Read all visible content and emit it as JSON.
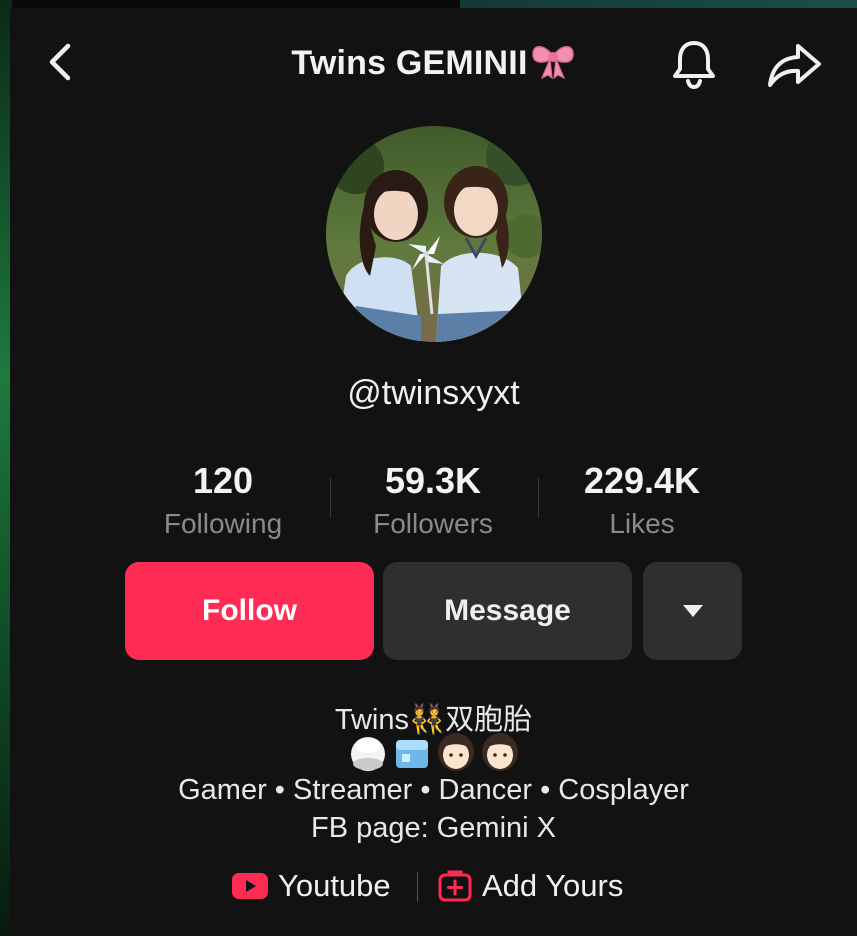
{
  "header": {
    "title": "Twins GEMINII",
    "title_emoji_icon": "ribbon-bow-icon"
  },
  "profile": {
    "username": "@twinsxyxt",
    "avatar_icon": "profile-photo-twins"
  },
  "stats": [
    {
      "value": "120",
      "label": "Following"
    },
    {
      "value": "59.3K",
      "label": "Followers"
    },
    {
      "value": "229.4K",
      "label": "Likes"
    }
  ],
  "actions": {
    "follow_label": "Follow",
    "message_label": "Message"
  },
  "bio": {
    "line1": "Twins👯双胞胎",
    "emoji_icons": [
      "rice-ball-icon",
      "ice-cube-icon",
      "girl-face-icon",
      "girl-face-icon"
    ],
    "line3": "Gamer • Streamer • Dancer • Cosplayer",
    "line4": "FB page: Gemini X"
  },
  "links": {
    "youtube_label": "Youtube",
    "add_yours_label": "Add Yours"
  },
  "colors": {
    "accent": "#fe2c55",
    "background": "#121212",
    "button_secondary": "#2f2f2f",
    "muted_text": "#8a8a8a"
  }
}
